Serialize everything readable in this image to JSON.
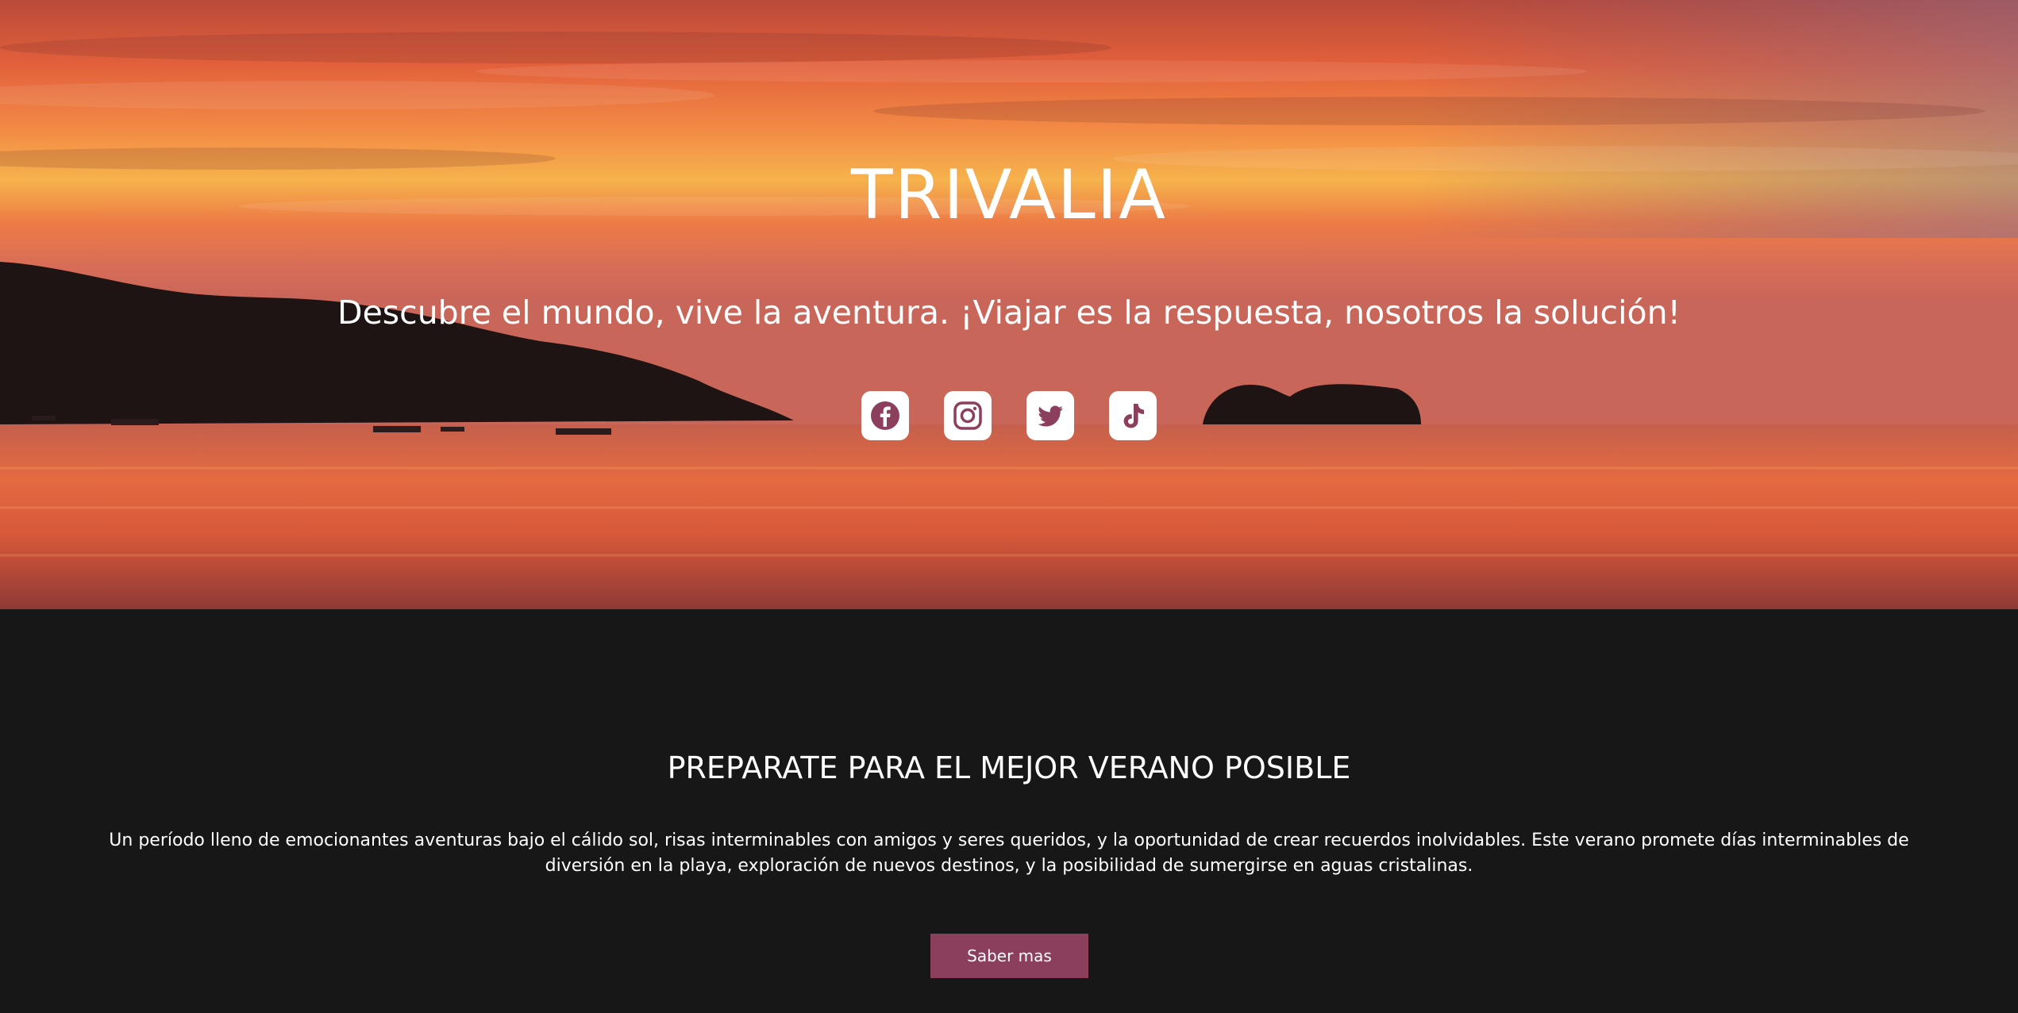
{
  "hero": {
    "title": "TRIVALIA",
    "subtitle": "Descubre el mundo, vive la aventura. ¡Viajar es la respuesta, nosotros la solución!",
    "socials": [
      {
        "icon": "facebook-icon"
      },
      {
        "icon": "instagram-icon"
      },
      {
        "icon": "twitter-icon"
      },
      {
        "icon": "tiktok-icon"
      }
    ]
  },
  "section": {
    "title": "PREPARATE PARA EL MEJOR VERANO POSIBLE",
    "text": "Un período lleno de emocionantes aventuras bajo el cálido sol, risas interminables con amigos y seres queridos, y la oportunidad de crear recuerdos inolvidables. Este verano promete días interminables de diversión en la playa, exploración de nuevos destinos, y la posibilidad de sumergirse en aguas cristalinas.",
    "button_label": "Saber mas"
  },
  "colors": {
    "accent": "#8b3f5d",
    "background": "#171717",
    "icon_color": "#8b3f5d"
  }
}
